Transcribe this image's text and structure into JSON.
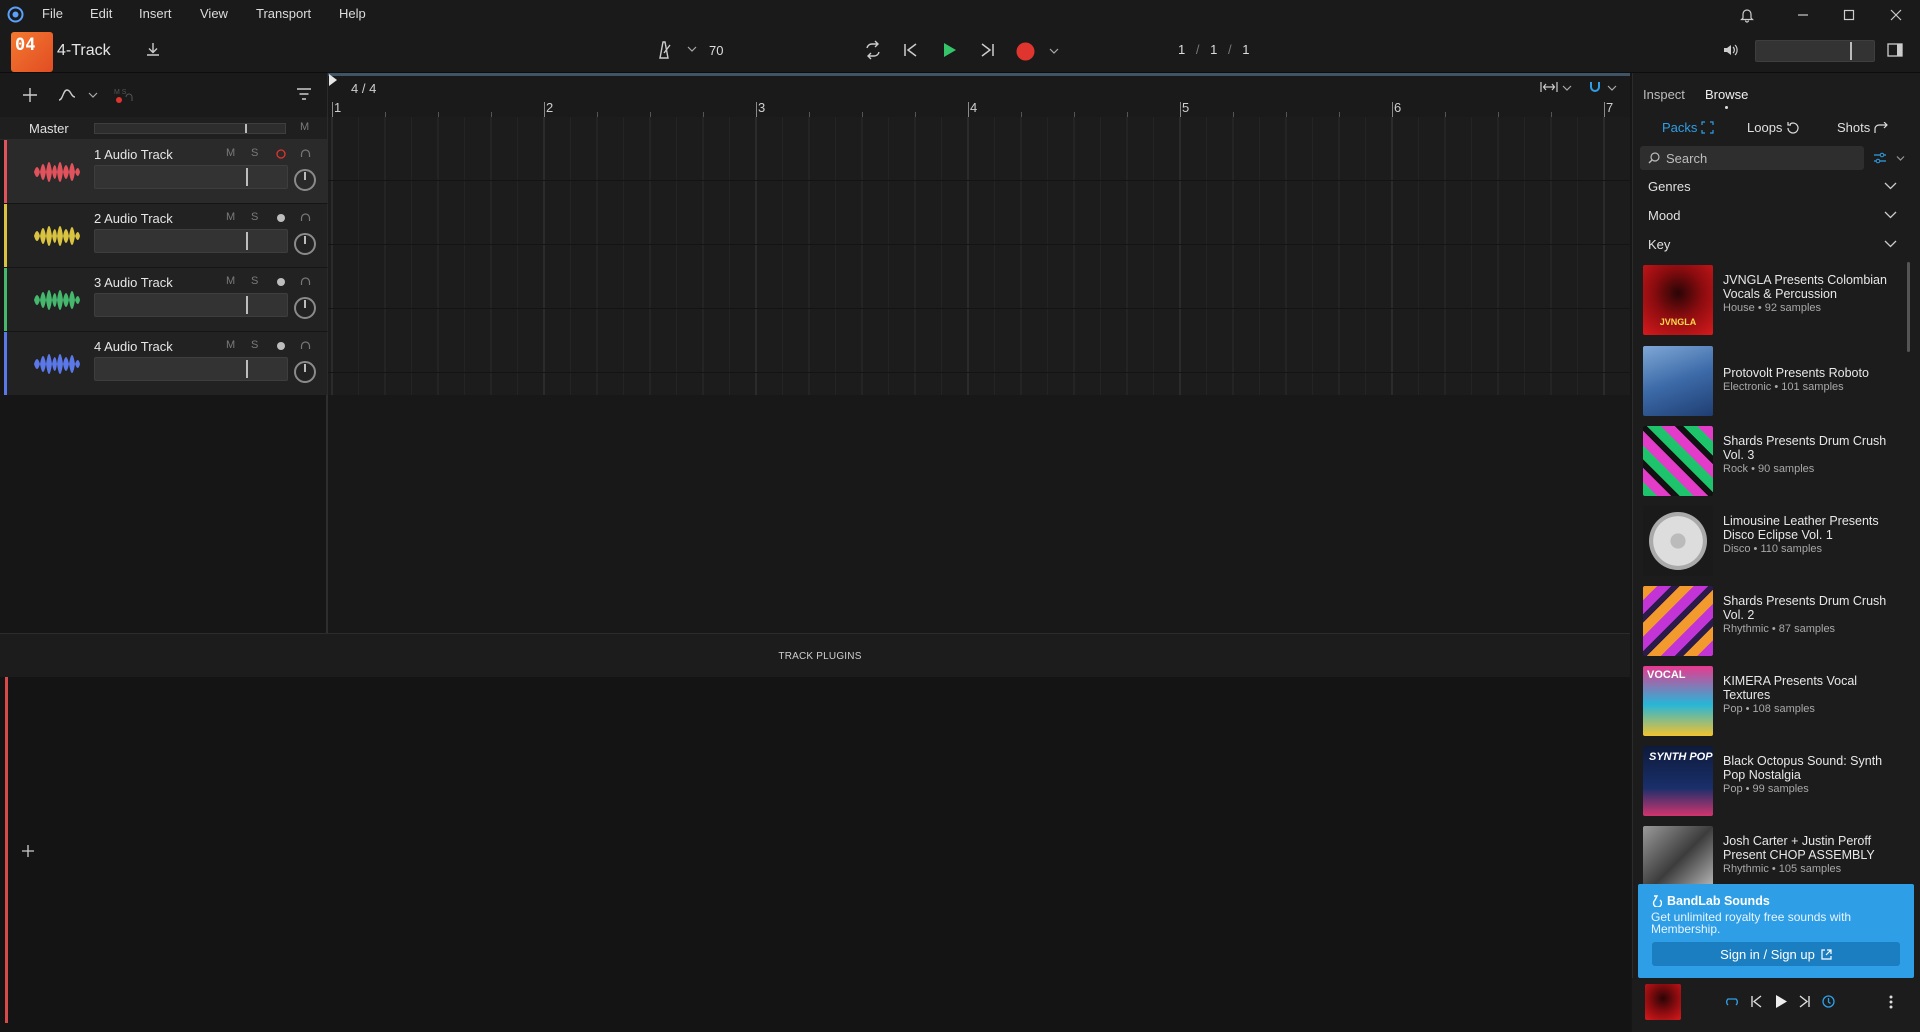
{
  "menu": {
    "items": [
      "File",
      "Edit",
      "Insert",
      "View",
      "Transport",
      "Help"
    ]
  },
  "project": {
    "badge": "04",
    "name": "4-Track"
  },
  "transport": {
    "tempo": "70",
    "position": [
      "1",
      "1",
      "1"
    ]
  },
  "timeline": {
    "time_signature": "4 / 4",
    "bars": [
      "1",
      "2",
      "3",
      "4",
      "5",
      "6",
      "7"
    ]
  },
  "master": {
    "label": "Master",
    "mute": "M"
  },
  "tracks": [
    {
      "number": "1",
      "name": "Audio Track",
      "color": "#e0525c",
      "mute": "M",
      "solo": "S"
    },
    {
      "number": "2",
      "name": "Audio Track",
      "color": "#d9c341",
      "mute": "M",
      "solo": "S"
    },
    {
      "number": "3",
      "name": "Audio Track",
      "color": "#45b86d",
      "mute": "M",
      "solo": "S"
    },
    {
      "number": "4",
      "name": "Audio Track",
      "color": "#5a78e8",
      "mute": "M",
      "solo": "S"
    }
  ],
  "plugins": {
    "title": "TRACK PLUGINS"
  },
  "browser": {
    "tabs": [
      "Inspect",
      "Browse"
    ],
    "sub_tabs": [
      "Packs",
      "Loops",
      "Shots"
    ],
    "search_placeholder": "Search",
    "filters": [
      "Genres",
      "Mood",
      "Key"
    ],
    "packs": [
      {
        "title": "JVNGLA Presents Colombian Vocals & Percussion",
        "meta": "House • 92 samples",
        "cover_text": "JVNGLA"
      },
      {
        "title": "Protovolt Presents Roboto",
        "meta": "Electronic • 101 samples",
        "cover_text": ""
      },
      {
        "title": "Shards Presents Drum Crush Vol. 3",
        "meta": "Rock • 90 samples",
        "cover_text": ""
      },
      {
        "title": "Limousine Leather Presents Disco Eclipse Vol. 1",
        "meta": "Disco • 110 samples",
        "cover_text": ""
      },
      {
        "title": "Shards Presents Drum Crush Vol. 2",
        "meta": "Rhythmic • 87 samples",
        "cover_text": ""
      },
      {
        "title": "KIMERA Presents Vocal Textures",
        "meta": "Pop • 108 samples",
        "cover_text": "VOCAL"
      },
      {
        "title": "Black Octopus Sound: Synth Pop Nostalgia",
        "meta": "Pop • 99 samples",
        "cover_text": "SYNTH POP"
      },
      {
        "title": "Josh Carter + Justin Peroff Present CHOP ASSEMBLY",
        "meta": "Rhythmic • 105 samples",
        "cover_text": ""
      }
    ],
    "promo": {
      "brand": "BandLab Sounds",
      "text": "Get unlimited royalty free sounds with Membership.",
      "button": "Sign in / Sign up"
    }
  },
  "colors": {
    "accent": "#2e9ee6",
    "record": "#e0352f",
    "play": "#35c46a",
    "badge": "#f06a2c"
  }
}
